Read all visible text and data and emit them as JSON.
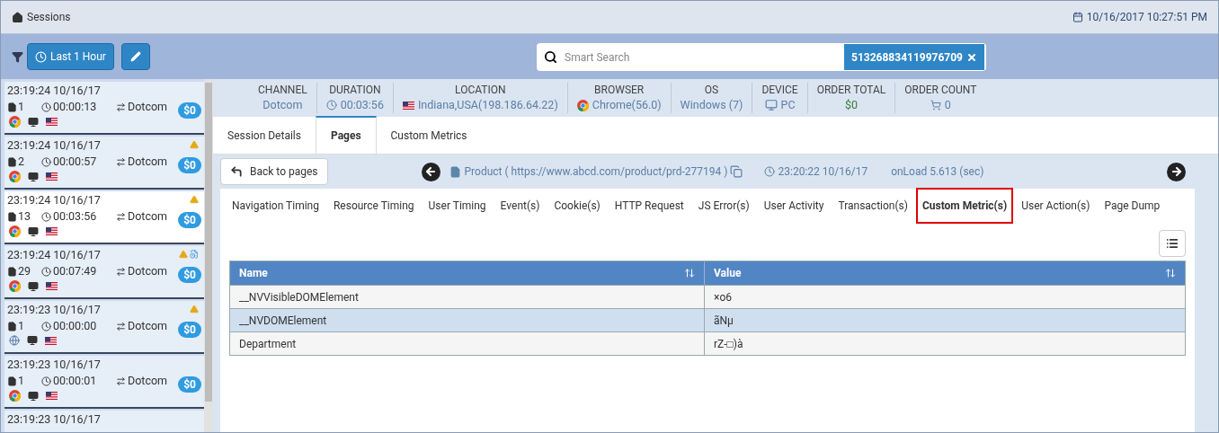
{
  "header": {
    "title": "Sessions",
    "datetime": "10/16/2017 10:27:51 PM"
  },
  "toolbar": {
    "time_range": "Last 1 Hour",
    "search": {
      "placeholder": "Smart Search",
      "token": "513268834119976709"
    }
  },
  "sessions": [
    {
      "time": "23:19:24 10/16/17",
      "pages": "1",
      "duration": "00:00:13",
      "channel": "Dotcom",
      "amount": "$0",
      "kind": "chrome",
      "warning": false,
      "extra": false,
      "selected": false
    },
    {
      "time": "23:19:24 10/16/17",
      "pages": "2",
      "duration": "00:00:57",
      "channel": "Dotcom",
      "amount": "$0",
      "kind": "chrome",
      "warning": true,
      "extra": false,
      "selected": false
    },
    {
      "time": "23:19:24 10/16/17",
      "pages": "13",
      "duration": "00:03:56",
      "channel": "Dotcom",
      "amount": "$0",
      "kind": "chrome",
      "warning": true,
      "extra": false,
      "selected": true
    },
    {
      "time": "23:19:24 10/16/17",
      "pages": "29",
      "duration": "00:07:49",
      "channel": "Dotcom",
      "amount": "$0",
      "kind": "chrome",
      "warning": true,
      "extra": true,
      "selected": false
    },
    {
      "time": "23:19:23 10/16/17",
      "pages": "1",
      "duration": "00:00:00",
      "channel": "Dotcom",
      "amount": "$0",
      "kind": "other",
      "warning": true,
      "extra": false,
      "selected": false
    },
    {
      "time": "23:19:23 10/16/17",
      "pages": "1",
      "duration": "00:00:01",
      "channel": "Dotcom",
      "amount": "$0",
      "kind": "chrome",
      "warning": false,
      "extra": false,
      "selected": false
    },
    {
      "time": "23:19:23 10/16/17",
      "selected": false
    }
  ],
  "summary": [
    {
      "label": "CHANNEL",
      "value": "Dotcom",
      "kind": "text"
    },
    {
      "label": "DURATION",
      "value": "00:03:56",
      "kind": "duration"
    },
    {
      "label": "LOCATION",
      "value": "Indiana,USA(198.186.64.22)",
      "kind": "location"
    },
    {
      "label": "BROWSER",
      "value": "Chrome(56.0)",
      "kind": "browser"
    },
    {
      "label": "OS",
      "value": "Windows (7)",
      "kind": "text"
    },
    {
      "label": "DEVICE",
      "value": "PC",
      "kind": "device"
    },
    {
      "label": "ORDER TOTAL",
      "value": "$0",
      "kind": "money"
    },
    {
      "label": "ORDER COUNT",
      "value": "0",
      "kind": "count"
    }
  ],
  "tabs": [
    {
      "label": "Session Details",
      "selected": false
    },
    {
      "label": "Pages",
      "selected": true
    },
    {
      "label": "Custom Metrics",
      "selected": false
    }
  ],
  "page_nav": {
    "back": "Back to pages",
    "page": "Product ( https://www.abcd.com/product/prd-277194 )",
    "time": "23:20:22 10/16/17",
    "onload": "onLoad 5.613 (sec)"
  },
  "subtabs": [
    {
      "label": "Navigation Timing",
      "selected": false
    },
    {
      "label": "Resource Timing",
      "selected": false
    },
    {
      "label": "User Timing",
      "selected": false
    },
    {
      "label": "Event(s)",
      "selected": false
    },
    {
      "label": "Cookie(s)",
      "selected": false
    },
    {
      "label": "HTTP Request",
      "selected": false
    },
    {
      "label": "JS Error(s)",
      "selected": false
    },
    {
      "label": "User Activity",
      "selected": false
    },
    {
      "label": "Transaction(s)",
      "selected": false
    },
    {
      "label": "Custom Metric(s)",
      "selected": true
    },
    {
      "label": "User Action(s)",
      "selected": false
    },
    {
      "label": "Page Dump",
      "selected": false
    }
  ],
  "table": {
    "columns": [
      "Name",
      "Value"
    ],
    "rows": [
      {
        "cells": [
          "__NVVisibleDOMElement",
          "×o6"
        ],
        "selected": false
      },
      {
        "cells": [
          "__NVDOMElement",
          "ãNµ"
        ],
        "selected": true
      },
      {
        "cells": [
          "Department",
          "rZ-□)à"
        ],
        "selected": false
      }
    ]
  }
}
